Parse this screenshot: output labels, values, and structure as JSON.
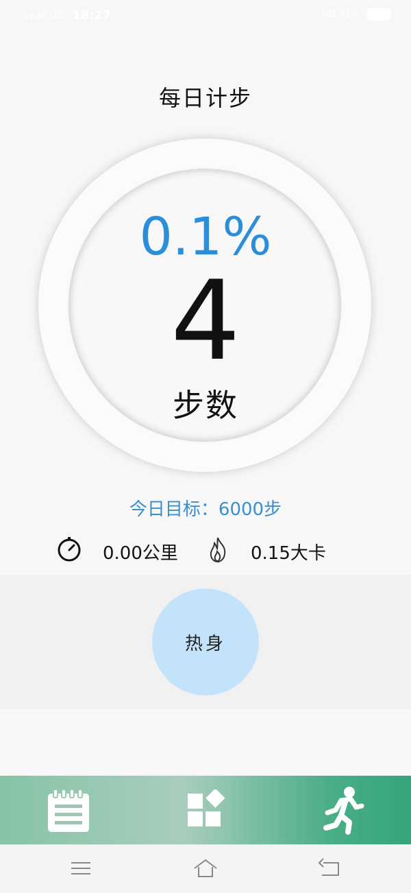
{
  "status_bar": {
    "carrier": "Intel 4G",
    "time": "18:27",
    "indicators": "HD 91%"
  },
  "page": {
    "title": "每日计步"
  },
  "progress": {
    "percent_text": "0.1%",
    "percent_value": 0.1,
    "steps": "4",
    "steps_label": "步数"
  },
  "goal": {
    "text": "今日目标：6000步"
  },
  "stats": {
    "distance_icon": "stopwatch-icon",
    "distance": "0.00公里",
    "calories_icon": "flame-icon",
    "calories": "0.15大卡"
  },
  "warmup": {
    "label": "热身"
  },
  "bottom_nav": {
    "tabs": [
      {
        "icon": "notepad-icon"
      },
      {
        "icon": "apps-grid-icon"
      },
      {
        "icon": "runner-icon"
      }
    ]
  },
  "colors": {
    "accent_blue": "#2a8fd8",
    "goal_blue": "#3a8fcf",
    "warmup_bg": "#c3e3fb",
    "nav_green": "#35a57b"
  }
}
